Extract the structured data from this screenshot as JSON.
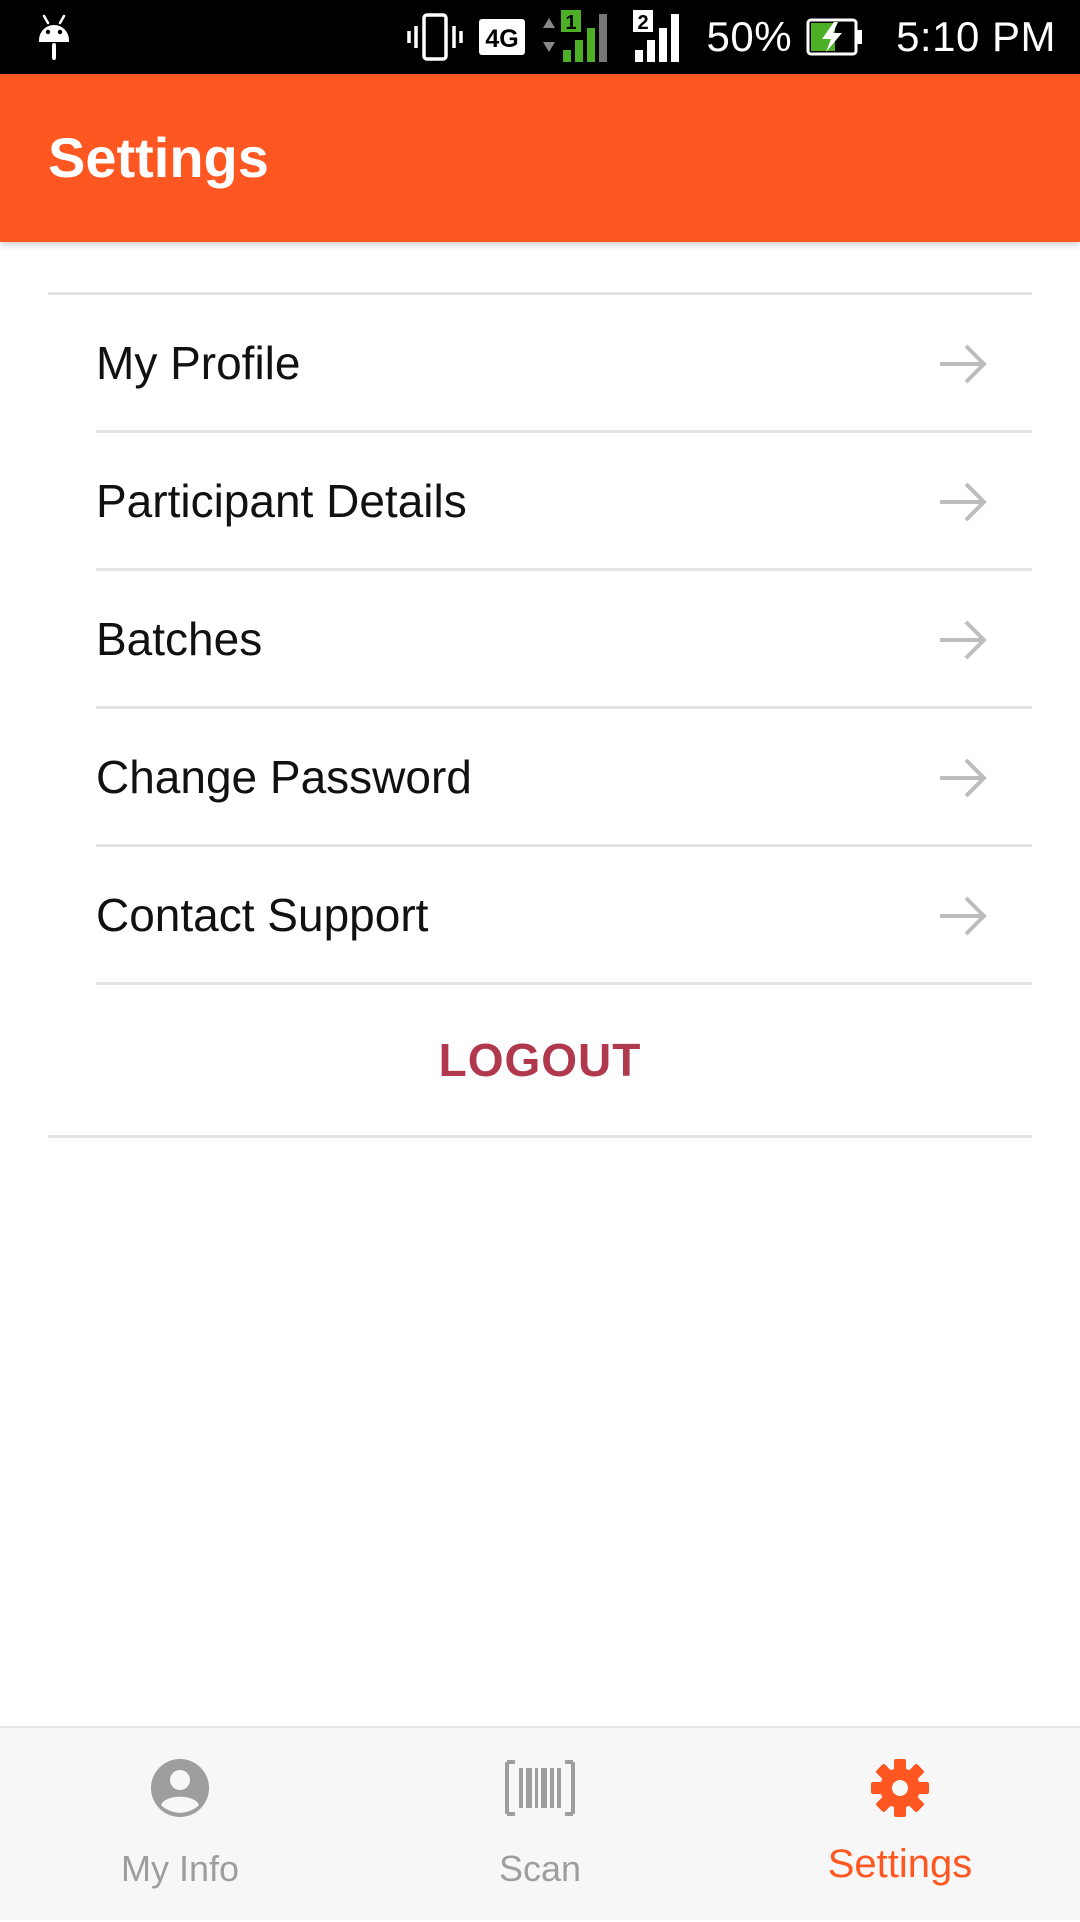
{
  "status_bar": {
    "network": "4G",
    "sim1_label": "1",
    "sim2_label": "2",
    "battery": "50%",
    "time": "5:10 PM",
    "icons": [
      "android-icon",
      "vibrate-icon",
      "signal-icon",
      "battery-charging-icon"
    ]
  },
  "app_bar": {
    "title": "Settings",
    "color": "#FF5722"
  },
  "settings": {
    "items": [
      {
        "label": "My Profile",
        "icon": "arrow-right-icon"
      },
      {
        "label": "Participant Details",
        "icon": "arrow-right-icon"
      },
      {
        "label": "Batches",
        "icon": "arrow-right-icon"
      },
      {
        "label": "Change Password",
        "icon": "arrow-right-icon"
      },
      {
        "label": "Contact Support",
        "icon": "arrow-right-icon"
      }
    ],
    "logout_label": "LOGOUT",
    "logout_color": "#B0394E"
  },
  "bottom_nav": {
    "items": [
      {
        "label": "My Info",
        "icon": "account-circle-icon",
        "active": false
      },
      {
        "label": "Scan",
        "icon": "barcode-icon",
        "active": false
      },
      {
        "label": "Settings",
        "icon": "gear-icon",
        "active": true
      }
    ],
    "active_color": "#FF5722",
    "inactive_color": "#9E9E9E"
  }
}
